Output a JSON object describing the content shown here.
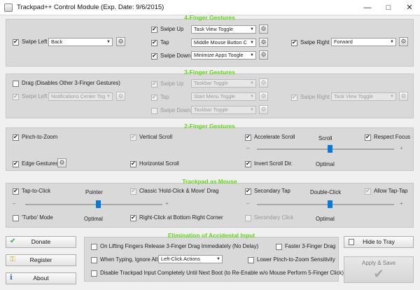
{
  "window": {
    "title": "Trackpad++ Control Module  (Exp. Date: 9/6/2015)",
    "minimize": "—",
    "maximize": "□",
    "close": "✕"
  },
  "four_finger": {
    "title": "4-Finger Gestures",
    "swipe_left": {
      "label": "Swipe Left",
      "value": "Back"
    },
    "swipe_up": {
      "label": "Swipe Up",
      "value": "Task View Toggle"
    },
    "tap": {
      "label": "Tap",
      "value": "Middle Mouse Button C"
    },
    "swipe_down": {
      "label": "Swipe Down",
      "value": "Minimize Apps Toogle"
    },
    "swipe_right": {
      "label": "Swipe Right",
      "value": "Forward"
    }
  },
  "three_finger": {
    "title": "3-Finger Gestures",
    "drag": {
      "label": "Drag (Disables Other 3-Finger Gestures)"
    },
    "swipe_left": {
      "label": "Swipe Left",
      "value": "Notifications Center Tog"
    },
    "swipe_up": {
      "label": "Swipe Up",
      "value": "Taskbar Toggle"
    },
    "tap": {
      "label": "Tap",
      "value": "Start Menu Toggle"
    },
    "swipe_down": {
      "label": "Swipe Down",
      "value": "Taskbar Toggle"
    },
    "swipe_right": {
      "label": "Swipe Right",
      "value": "Task View Toggle"
    }
  },
  "two_finger": {
    "title": "2-Finger Gestures",
    "pinch": "Pinch-to-Zoom",
    "vscroll": "Vertical Scroll",
    "accel": "Accelerate Scroll",
    "scroll_caption": "Scroll",
    "respect_focus": "Respect Focus",
    "edge": "Edge Gestures",
    "hscroll": "Horizontal Scroll",
    "invert": "Invert Scroll Dir.",
    "optimal": "Optimal",
    "minus": "–",
    "plus": "+",
    "scroll_level": 0.53
  },
  "trackpad_mouse": {
    "title": "Trackpad as Mouse",
    "tap_to_click": "Tap-to-Click",
    "pointer_caption": "Pointer",
    "classic_drag": "Classic 'Hold-Click & Move' Drag",
    "secondary_tap": "Secondary Tap",
    "double_click_caption": "Double-Click",
    "allow_tap_tap": "Allow Tap-Tap",
    "turbo": "'Turbo' Mode",
    "optimal": "Optimal",
    "right_click": "Right-Click at Bottom Right Corner",
    "secondary_click": "Secondary Click",
    "optimal2": "Optimal",
    "minus": "–",
    "plus": "+",
    "pointer_level": 0.53,
    "double_click_level": 0.53
  },
  "accidental": {
    "title": "Elimination of Accidental Input",
    "lift_release": "On Lifting Fingers Release 3-Finger Drag Immediately (No Delay)",
    "faster_drag": "Faster 3-Finger Drag",
    "when_typing": "When Typing, Ignore All",
    "when_typing_value": "Left-Click Actions",
    "lower_pinch": "Lower Pinch-to-Zoom Sensitivity",
    "disable_input": "Disable Trackpad Input Completely Until Next Boot (to Re-Enable w/o Mouse Perform 5-Finger Click)"
  },
  "buttons": {
    "donate": "Donate",
    "register": "Register",
    "about": "About",
    "hide": "Hide to Tray",
    "apply": "Apply & Save"
  },
  "icons": {
    "settings": "gear-icon",
    "accent": "#62d418",
    "slider": "#0a78d7"
  }
}
